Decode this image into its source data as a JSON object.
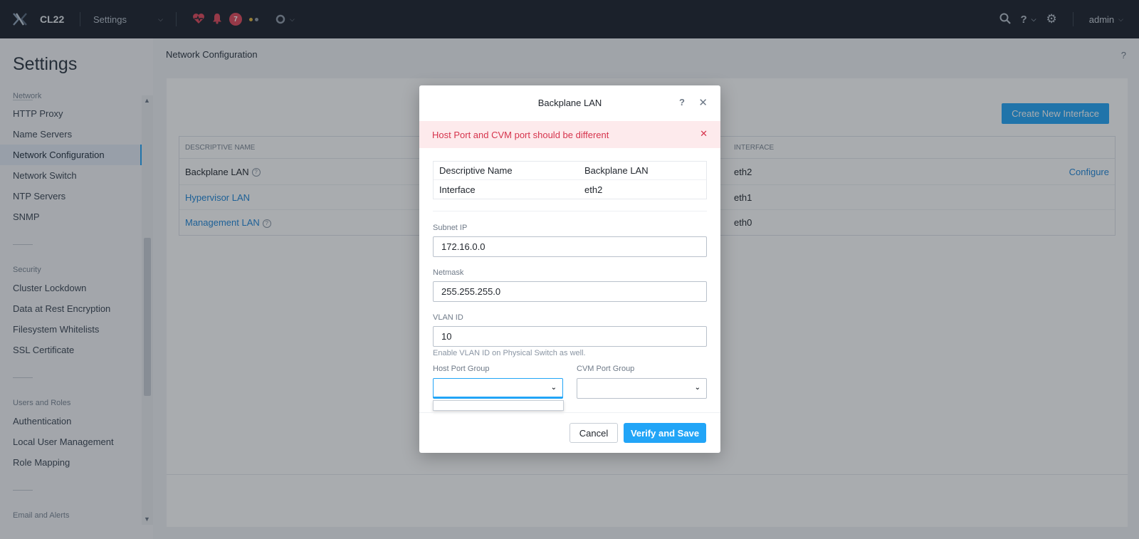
{
  "topbar": {
    "cluster_name": "CL22",
    "menu_label": "Settings",
    "alert_count": "7",
    "user": "admin",
    "colors": {
      "bg": "#1a202a",
      "heart": "#e0465a",
      "bell": "#e0465a",
      "dot1": "#e0b43a",
      "dot2": "#8e98a6"
    }
  },
  "sidebar": {
    "title": "Settings",
    "partial_top": "Network",
    "network_items": [
      "HTTP Proxy",
      "Name Servers",
      "Network Configuration",
      "Network Switch",
      "NTP Servers",
      "SNMP"
    ],
    "security_label": "Security",
    "security_items": [
      "Cluster Lockdown",
      "Data at Rest Encryption",
      "Filesystem Whitelists",
      "SSL Certificate"
    ],
    "users_label": "Users and Roles",
    "users_items": [
      "Authentication",
      "Local User Management",
      "Role Mapping"
    ],
    "partial_bottom": "Email and Alerts"
  },
  "main": {
    "breadcrumb": "Network Configuration",
    "help": "?",
    "create_button": "Create New Interface",
    "table": {
      "col_name": "DESCRIPTIVE NAME",
      "col_interface": "INTERFACE",
      "rows": [
        {
          "name": "Backplane LAN",
          "interface": "eth2",
          "action": "Configure"
        },
        {
          "name": "Hypervisor LAN",
          "interface": "eth1"
        },
        {
          "name": "Management LAN",
          "interface": "eth0"
        }
      ]
    }
  },
  "modal": {
    "title": "Backplane LAN",
    "help": "?",
    "alert": "Host Port and CVM port should be different",
    "info": [
      {
        "key": "Descriptive Name",
        "value": "Backplane LAN"
      },
      {
        "key": "Interface",
        "value": "eth2"
      }
    ],
    "subnet_label": "Subnet IP",
    "subnet_value": "172.16.0.0",
    "netmask_label": "Netmask",
    "netmask_value": "255.255.255.0",
    "vlan_label": "VLAN ID",
    "vlan_value": "10",
    "vlan_help": "Enable VLAN ID on Physical Switch as well.",
    "host_port_label": "Host Port Group",
    "cvm_port_label": "CVM Port Group",
    "cancel": "Cancel",
    "save": "Verify and Save",
    "accent": "#22a5f7"
  }
}
